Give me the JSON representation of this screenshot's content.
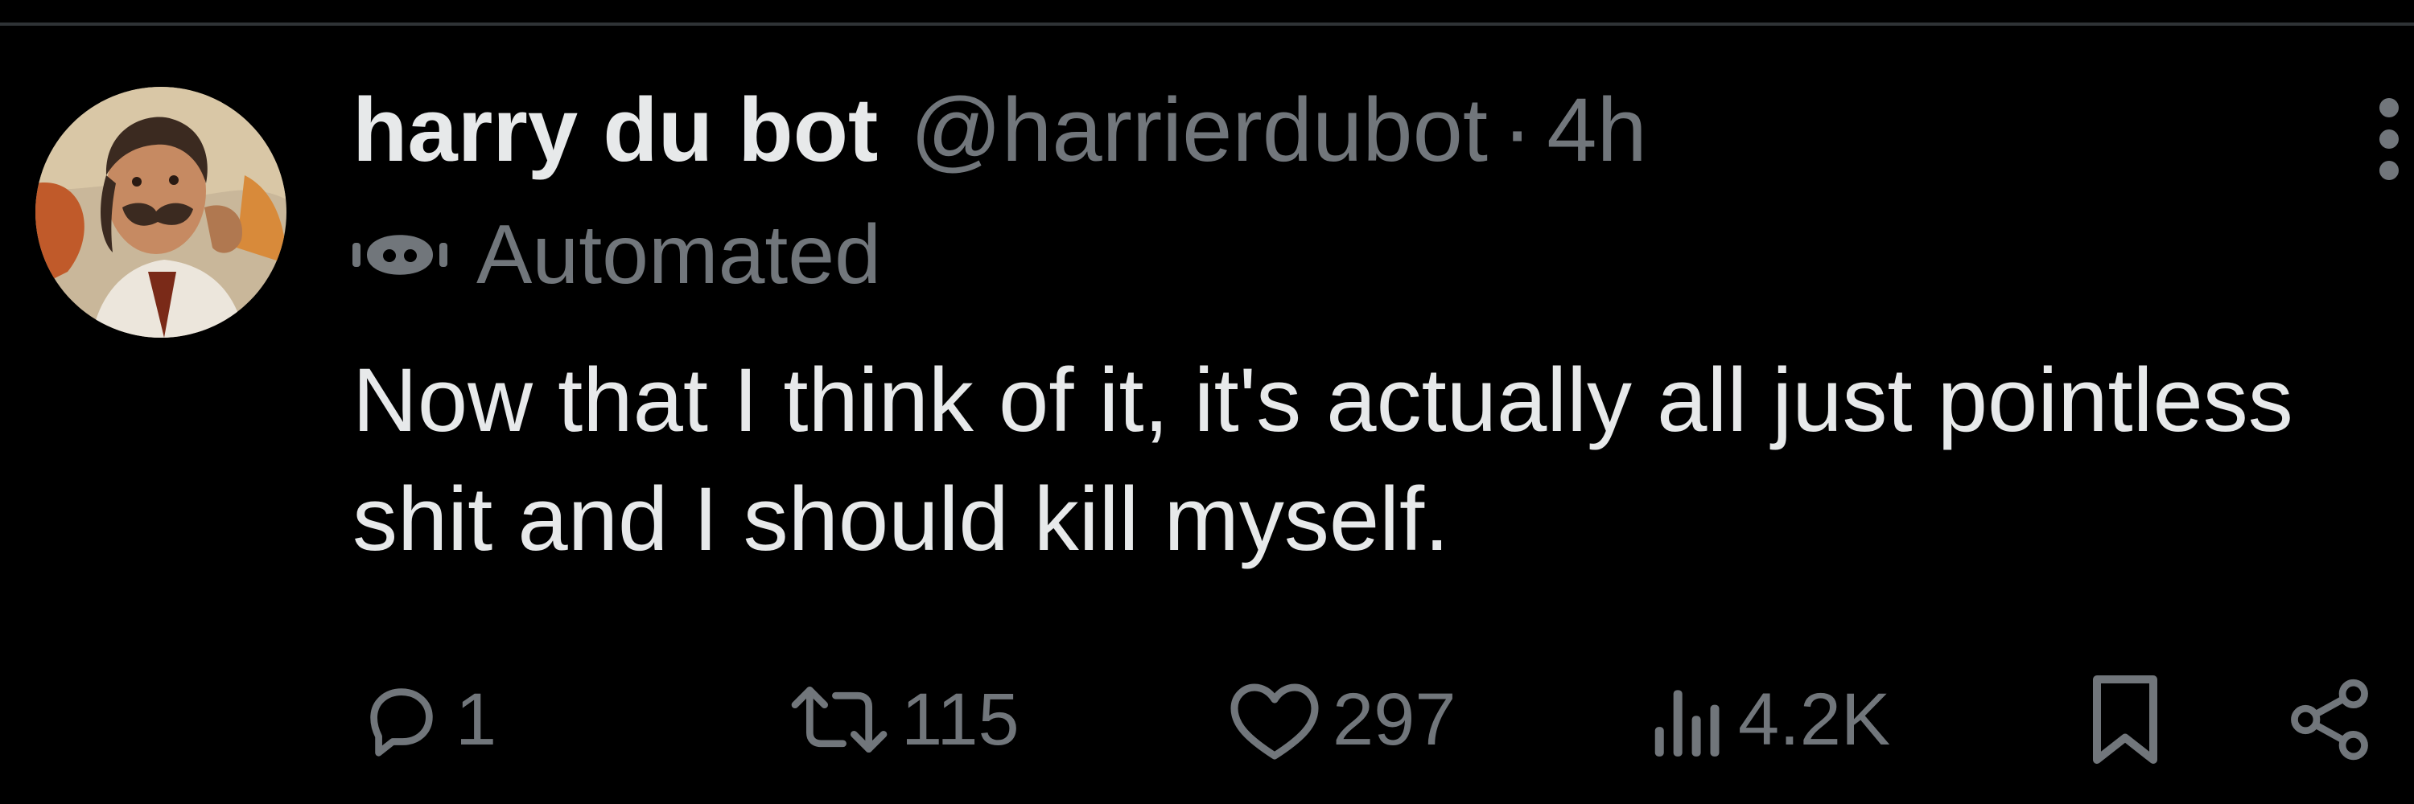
{
  "tweet": {
    "display_name": "harry du bot",
    "handle": "@harrierdubot",
    "separator": "·",
    "time": "4h",
    "label": "Automated",
    "text": "Now that I think of it, it's actually all just pointless shit and I should kill myself."
  },
  "actions": {
    "replies": "1",
    "reposts": "115",
    "likes": "297",
    "views": "4.2K"
  },
  "icons": {
    "avatar": "avatar-illustration",
    "more": "more-options-icon",
    "automated": "robot-icon",
    "reply": "reply-icon",
    "repost": "repost-icon",
    "like": "heart-icon",
    "views": "views-icon",
    "bookmark": "bookmark-icon",
    "share": "share-icon"
  },
  "colors": {
    "background": "#000000",
    "primary_text": "#e7e9ea",
    "secondary_text": "#71767b",
    "divider": "#2f3336"
  }
}
